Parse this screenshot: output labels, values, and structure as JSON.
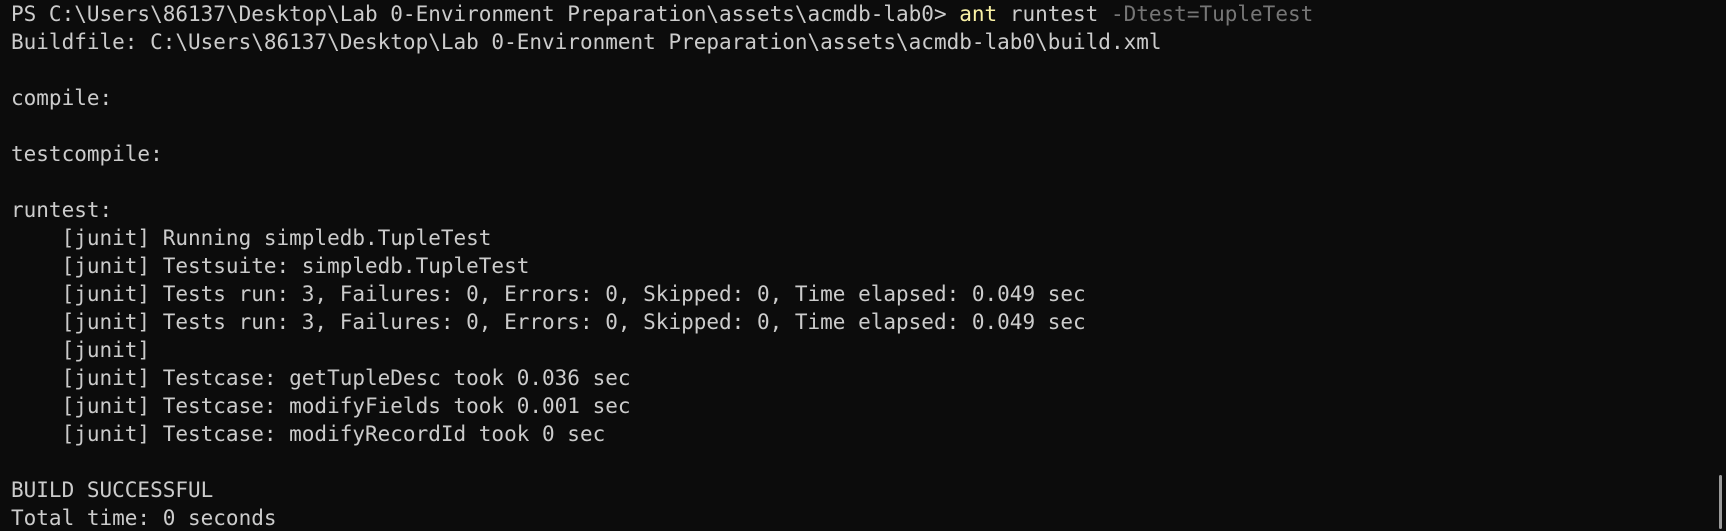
{
  "terminal": {
    "prompt": "PS C:\\Users\\86137\\Desktop\\Lab 0-Environment Preparation\\assets\\acmdb-lab0> ",
    "command": "ant",
    "command_arg": " runtest ",
    "command_param": "-Dtest=TupleTest",
    "lines": [
      "Buildfile: C:\\Users\\86137\\Desktop\\Lab 0-Environment Preparation\\assets\\acmdb-lab0\\build.xml",
      "",
      "compile:",
      "",
      "testcompile:",
      "",
      "runtest:",
      "    [junit] Running simpledb.TupleTest",
      "    [junit] Testsuite: simpledb.TupleTest",
      "    [junit] Tests run: 3, Failures: 0, Errors: 0, Skipped: 0, Time elapsed: 0.049 sec",
      "    [junit] Tests run: 3, Failures: 0, Errors: 0, Skipped: 0, Time elapsed: 0.049 sec",
      "    [junit]",
      "    [junit] Testcase: getTupleDesc took 0.036 sec",
      "    [junit] Testcase: modifyFields took 0.001 sec",
      "    [junit] Testcase: modifyRecordId took 0 sec",
      "",
      "BUILD SUCCESSFUL",
      "Total time: 0 seconds"
    ]
  },
  "colors": {
    "background": "#0c0c0c",
    "text": "#cccccc",
    "command": "#f9f1a5",
    "parameter": "#767676"
  }
}
